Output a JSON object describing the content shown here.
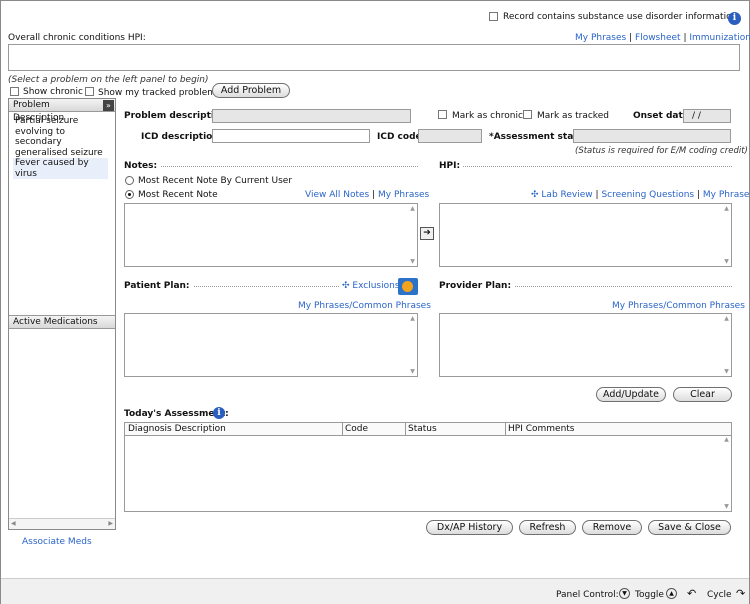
{
  "top": {
    "substance_label": "Record contains substance use disorder information",
    "hpi_label": "Overall chronic conditions HPI:",
    "links": [
      "My Phrases",
      "Flowsheet",
      "Immunizations"
    ],
    "separators": [
      "|",
      "|"
    ]
  },
  "left": {
    "hint": "(Select a problem on the left panel to begin)",
    "show_chronic": "Show chronic",
    "show_tracked": "Show my tracked problems",
    "add_problem": "Add Problem",
    "problems_header": "Problem Description",
    "expand_symbol": "»",
    "problems": [
      {
        "text": "Partial seizure evolving to secondary generalised seizure"
      },
      {
        "text": "Fever caused by virus"
      }
    ],
    "meds_header": "Active Medications",
    "associate_meds": "Associate Meds"
  },
  "form": {
    "problem_description_label": "Problem description:",
    "mark_chronic": "Mark as chronic",
    "mark_tracked": "Mark as tracked",
    "onset_label": "Onset date:",
    "onset_value": "/ /",
    "icd_description_label": "ICD description:",
    "icd_code_label": "ICD code:",
    "assessment_status_label": "*Assessment status:",
    "status_note": "(Status is required for E/M coding credit)"
  },
  "notes": {
    "header": "Notes:",
    "radio_by_user": "Most Recent Note By Current User",
    "radio_recent": "Most Recent Note",
    "view_all": "View All Notes",
    "sep": "|",
    "my_phrases": "My Phrases"
  },
  "hpi": {
    "header": "HPI:",
    "lab_review": "Lab Review",
    "screening": "Screening Questions",
    "my_phrases": "My Phrases",
    "seps": [
      "|",
      "|"
    ]
  },
  "patient_plan": {
    "header": "Patient Plan:",
    "exclusions": "Exclusions",
    "phrases": "My Phrases/Common Phrases"
  },
  "provider_plan": {
    "header": "Provider Plan:",
    "phrases": "My Phrases/Common Phrases"
  },
  "actions": {
    "add_update": "Add/Update",
    "clear": "Clear"
  },
  "assessment": {
    "header": "Today's Assessment:",
    "columns": [
      "Diagnosis Description",
      "Code",
      "Status",
      "HPI Comments"
    ]
  },
  "bottom_buttons": [
    "Dx/AP History",
    "Refresh",
    "Remove",
    "Save & Close"
  ],
  "panel_control": {
    "label": "Panel Control:",
    "toggle": "Toggle",
    "cycle": "Cycle"
  },
  "colors": {
    "link": "#2a64c9",
    "info": "#2a5fbf",
    "selected_row": "#e8eefa"
  }
}
